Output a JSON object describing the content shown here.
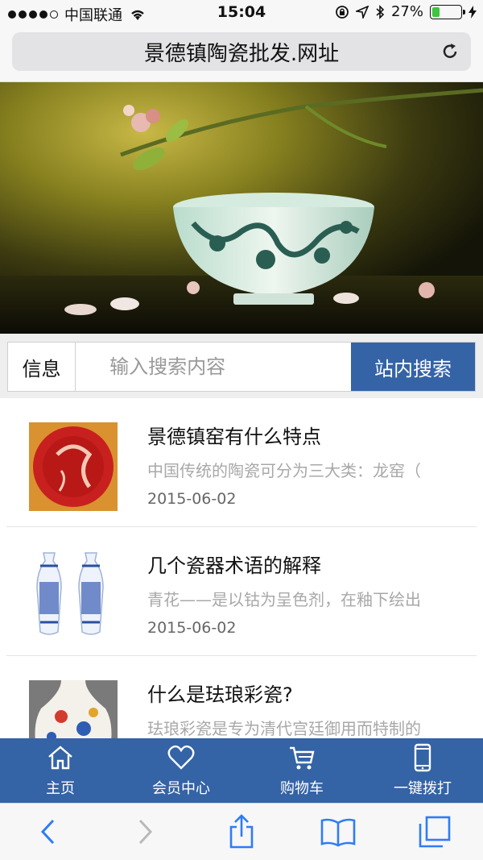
{
  "status_bar": {
    "carrier": "中国联通",
    "time": "15:04",
    "battery_percent": "27%",
    "battery_level": 0.27,
    "icons": [
      "signal-icon",
      "wifi-icon",
      "rotation-lock-icon",
      "location-icon",
      "bluetooth-icon",
      "battery-icon",
      "charging-icon"
    ]
  },
  "address_bar": {
    "url": "景德镇陶瓷批发.网址",
    "reload_icon": "reload-icon"
  },
  "search": {
    "category": "信息",
    "placeholder": "输入搜索内容",
    "button_label": "站内搜索"
  },
  "articles": [
    {
      "title": "景德镇窑有什么特点",
      "summary": "中国传统的陶瓷可分为三大类：龙窑（",
      "date": "2015-06-02"
    },
    {
      "title": "几个瓷器术语的解释",
      "summary": "青花——是以钴为呈色剂，在釉下绘出",
      "date": "2015-06-02"
    },
    {
      "title": "什么是珐琅彩瓷?",
      "summary": "珐琅彩瓷是专为清代宫廷御用而特制的",
      "date": ""
    }
  ],
  "tabbar": {
    "items": [
      {
        "label": "主页",
        "icon": "home-icon"
      },
      {
        "label": "会员中心",
        "icon": "heart-icon"
      },
      {
        "label": "购物车",
        "icon": "cart-icon"
      },
      {
        "label": "一键拨打",
        "icon": "phone-icon"
      }
    ]
  },
  "colors": {
    "accent": "#3463a6",
    "battery_green": "#3ec63e",
    "summary_gray": "#a8a8a8"
  }
}
